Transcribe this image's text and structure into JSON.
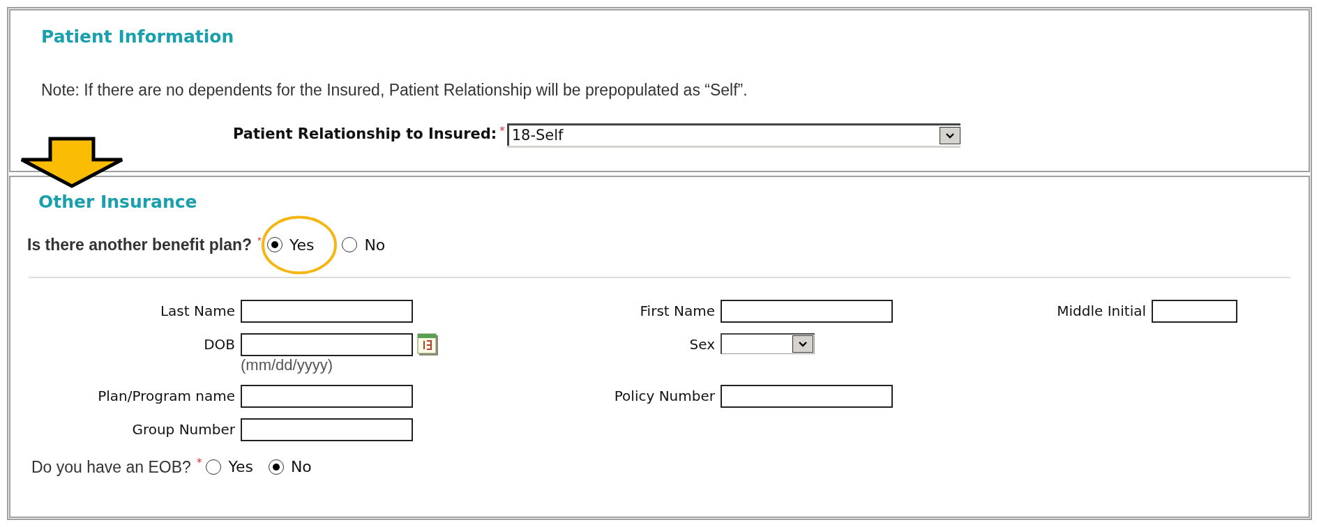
{
  "patient_information": {
    "title": "Patient Information",
    "note": "Note: If there are no dependents for the Insured, Patient Relationship will be prepopulated as “Self”.",
    "relationship": {
      "label": "Patient Relationship to Insured:",
      "required_mark": "*",
      "value": "18-Self"
    }
  },
  "other_insurance": {
    "title": "Other Insurance",
    "benefit_plan": {
      "label": "Is there another benefit plan?",
      "required_mark": "*",
      "options": [
        {
          "label": "Yes",
          "selected": true
        },
        {
          "label": "No",
          "selected": false
        }
      ]
    },
    "rows": [
      [
        {
          "label": "Last Name",
          "kind": "text"
        },
        {
          "label": "First Name",
          "kind": "text"
        },
        {
          "label": "Middle Initial",
          "kind": "short"
        }
      ],
      [
        {
          "label": "DOB",
          "kind": "date",
          "hint": "(mm/dd/yyyy)"
        },
        {
          "label": "Sex",
          "kind": "select"
        }
      ],
      [
        {
          "label": "Plan/Program name",
          "kind": "text"
        },
        {
          "label": "Policy Number",
          "kind": "text"
        }
      ],
      [
        {
          "label": "Group Number",
          "kind": "text"
        }
      ]
    ],
    "eob": {
      "label": "Do you have an EOB?",
      "required_mark": "*",
      "options": [
        {
          "label": "Yes",
          "selected": false
        },
        {
          "label": "No",
          "selected": true
        }
      ]
    }
  },
  "annotations": {
    "arrow": true,
    "circle": true
  }
}
